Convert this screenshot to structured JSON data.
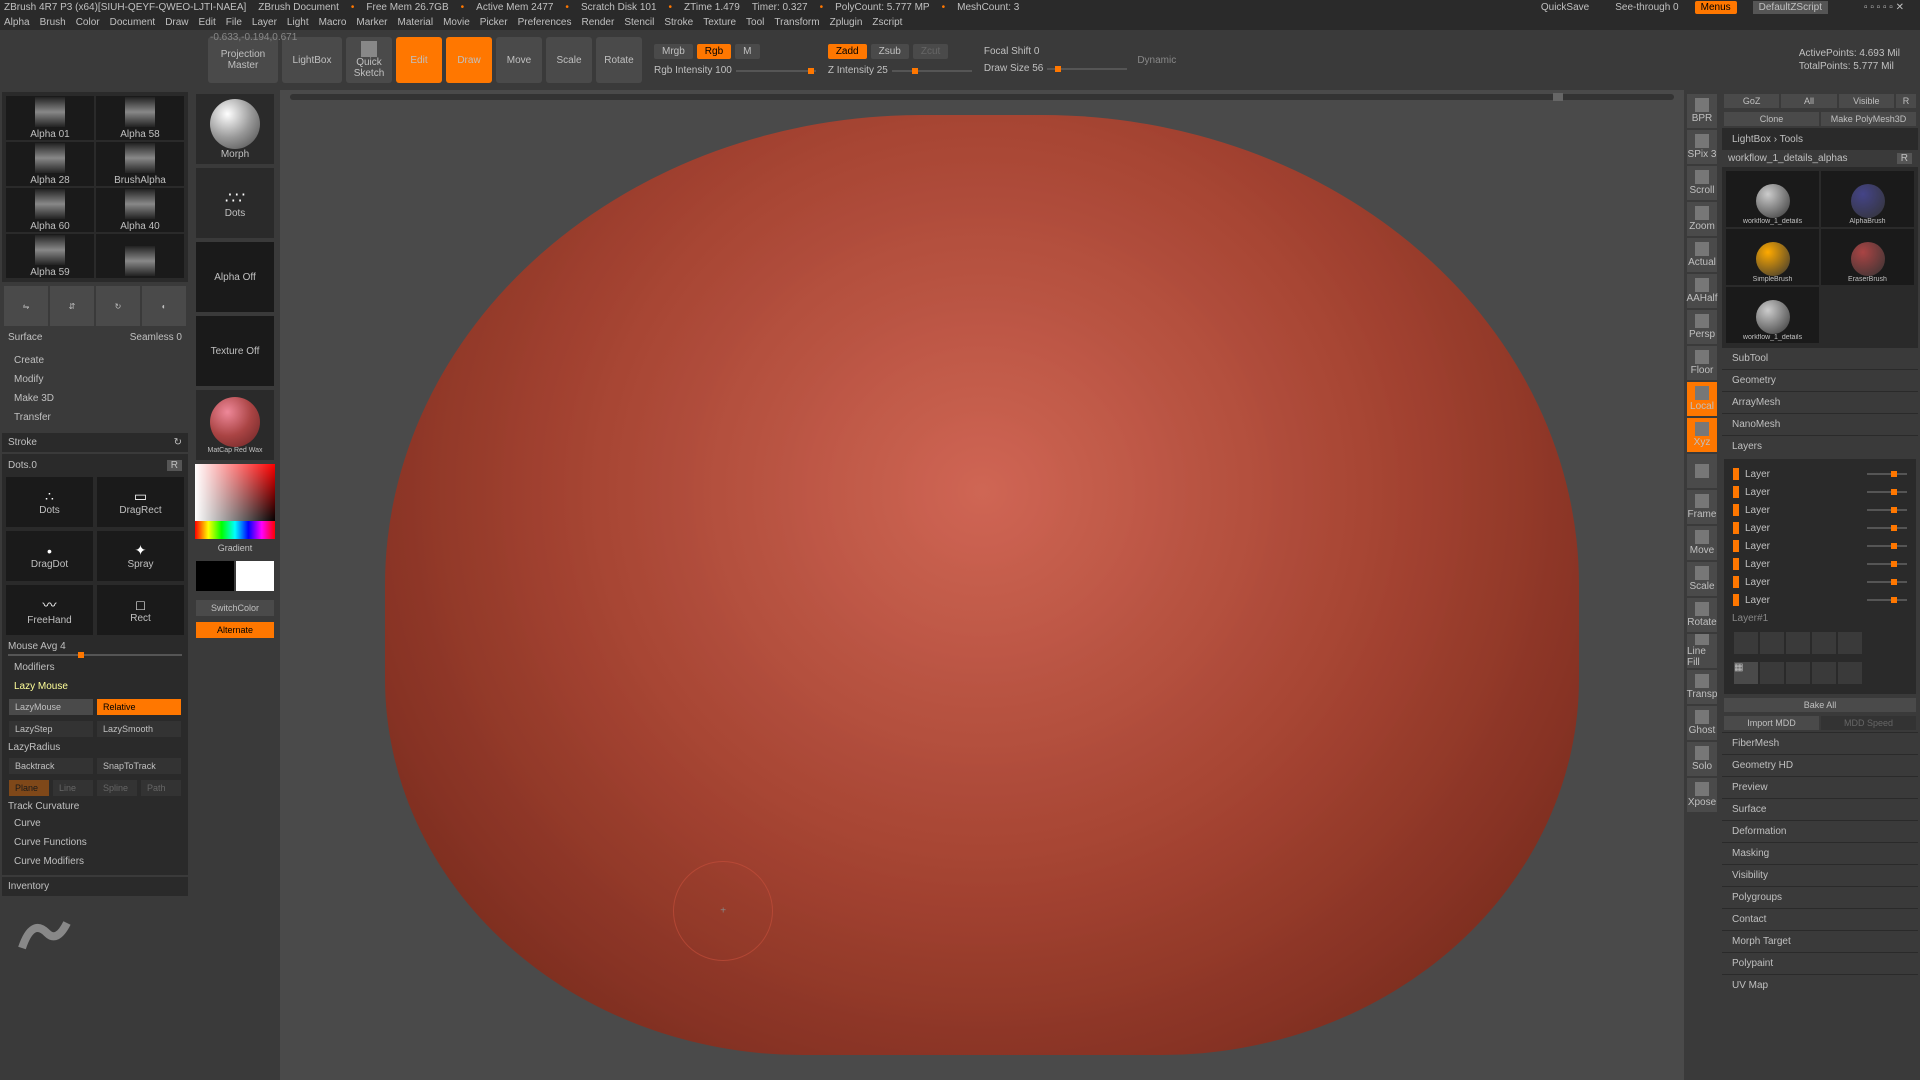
{
  "titlebar": {
    "app": "ZBrush 4R7 P3 (x64)[SIUH-QEYF-QWEO-LJTI-NAEA]",
    "doc": "ZBrush Document",
    "freemem": "Free Mem 26.7GB",
    "activemem": "Active Mem 2477",
    "scratch": "Scratch Disk 101",
    "ztime": "ZTime 1.479",
    "timer": "Timer: 0.327",
    "polycount": "PolyCount: 5.777 MP",
    "meshcount": "MeshCount: 3",
    "quicksave": "QuickSave",
    "seethrough": "See-through  0",
    "menus": "Menus",
    "script": "DefaultZScript"
  },
  "menu": [
    "Alpha",
    "Brush",
    "Color",
    "Document",
    "Draw",
    "Edit",
    "File",
    "Layer",
    "Light",
    "Macro",
    "Marker",
    "Material",
    "Movie",
    "Picker",
    "Preferences",
    "Render",
    "Stencil",
    "Stroke",
    "Texture",
    "Tool",
    "Transform",
    "Zplugin",
    "Zscript"
  ],
  "coord": "-0.633,-0.194,0.671",
  "toolbar": {
    "projection": "Projection Master",
    "lightbox": "LightBox",
    "quicksketch": "Quick Sketch",
    "edit": "Edit",
    "draw": "Draw",
    "move": "Move",
    "scale": "Scale",
    "rotate": "Rotate",
    "mrgb": "Mrgb",
    "rgb": "Rgb",
    "m": "M",
    "rgbintensity": "Rgb Intensity 100",
    "zadd": "Zadd",
    "zsub": "Zsub",
    "zcut": "Zcut",
    "zintensity": "Z Intensity 25",
    "focalshift": "Focal Shift 0",
    "drawsize": "Draw Size 56",
    "dynamic": "Dynamic",
    "activepoints": "ActivePoints: 4.693 Mil",
    "totalpoints": "TotalPoints: 5.777 Mil"
  },
  "alphas": [
    "Alpha 01",
    "Alpha 58",
    "Alpha 28",
    "BrushAlpha",
    "Alpha 60",
    "Alpha 40",
    "Alpha 59",
    ""
  ],
  "leftbtns": {
    "surface": "Surface",
    "seamless": "Seamless 0",
    "create": "Create",
    "modify": "Modify",
    "make3d": "Make 3D",
    "transfer": "Transfer"
  },
  "stroke": {
    "title": "Stroke",
    "current": "Dots.0",
    "types": [
      "Dots",
      "DragRect",
      "DragDot",
      "Spray",
      "FreeHand",
      "Rect"
    ],
    "mouseavg": "Mouse Avg 4",
    "modifiers": "Modifiers",
    "lazymouse": "Lazy Mouse",
    "lazybtn": "LazyMouse",
    "relative": "Relative",
    "lazystep": "LazyStep",
    "lazysmooth": "LazySmooth",
    "lazyradius": "LazyRadius",
    "backtrack": "Backtrack",
    "snaptrack": "SnapToTrack",
    "plane": "Plane",
    "line": "Line",
    "spline": "Spline",
    "path": "Path",
    "trackcurv": "Track Curvature",
    "curve": "Curve",
    "curvefunc": "Curve Functions",
    "curvemod": "Curve Modifiers",
    "inventory": "Inventory"
  },
  "lefttools": {
    "morph": "Morph",
    "dots": "Dots",
    "alphaoff": "Alpha Off",
    "textureoff": "Texture Off",
    "matcap": "MatCap Red Wax",
    "gradient": "Gradient",
    "switchcolor": "SwitchColor",
    "alternate": "Alternate"
  },
  "righttools": [
    "BPR",
    "SPix 3",
    "Scroll",
    "Zoom",
    "Actual",
    "AAHalf",
    "Persp",
    "Floor",
    "Local",
    "Xyz",
    "",
    "Frame",
    "Move",
    "Scale",
    "Rotate",
    "Line Fill",
    "Transp",
    "Ghost",
    "Solo",
    "Xpose"
  ],
  "rightpanel": {
    "top": [
      "GoZ",
      "All",
      "Visible",
      "R"
    ],
    "clone": "Clone",
    "makepoly": "Make PolyMesh3D",
    "lightbox": "LightBox › Tools",
    "toolname": "workflow_1_details_alphas",
    "brushes": [
      "workflow_1_details",
      "AlphaBrush",
      "SimpleBrush",
      "EraserBrush",
      "workflow_1_details"
    ],
    "sections": [
      "SubTool",
      "Geometry",
      "ArrayMesh",
      "NanoMesh",
      "Layers"
    ],
    "layers": [
      "Layer",
      "Layer",
      "Layer",
      "Layer",
      "Layer",
      "Layer",
      "Layer",
      "Layer"
    ],
    "layername": "Layer#1",
    "bakeall": "Bake All",
    "importmdd": "Import MDD",
    "mddspeed": "MDD Speed",
    "sections2": [
      "FiberMesh",
      "Geometry HD",
      "Preview",
      "Surface",
      "Deformation",
      "Masking",
      "Visibility",
      "Polygroups",
      "Contact",
      "Morph Target",
      "Polypaint",
      "UV Map"
    ]
  }
}
